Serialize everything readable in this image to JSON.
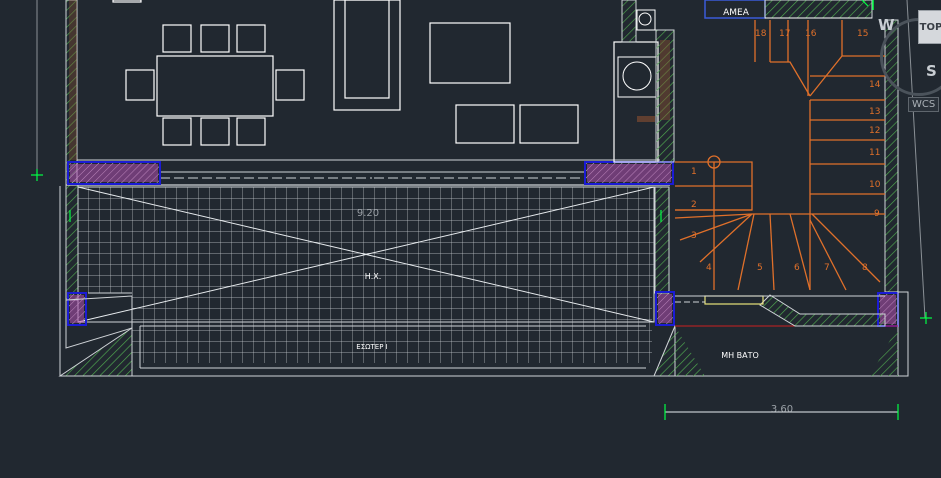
{
  "drawing": {
    "dimension_main": "9.20",
    "dimension_bottom": "3.60",
    "room_hx": "Η.Χ.",
    "room_esoteriki": "ΕΣΩΤΕΡ Ι",
    "room_mh_bato": "ΜΗ ΒΑΤΟ",
    "label_amea": "ΑΜΕΑ",
    "stair_numbers_left": [
      "1",
      "2",
      "3",
      "4",
      "5",
      "6",
      "7",
      "8"
    ],
    "stair_numbers_right": [
      "9",
      "10",
      "11",
      "12",
      "13",
      "14"
    ],
    "stair_numbers_top": [
      "15",
      "16",
      "17",
      "18"
    ]
  },
  "viewcube": {
    "top_label": "TOP",
    "west_label": "W",
    "south_label": "S",
    "wcs_label": "WCS"
  },
  "colors": {
    "background": "#212830",
    "lines": "#ffffff",
    "stairs": "#e0702a",
    "hatch_green": "#3f9a3f",
    "hatch_magenta": "#c04fc0",
    "marker": "#00ff44"
  }
}
